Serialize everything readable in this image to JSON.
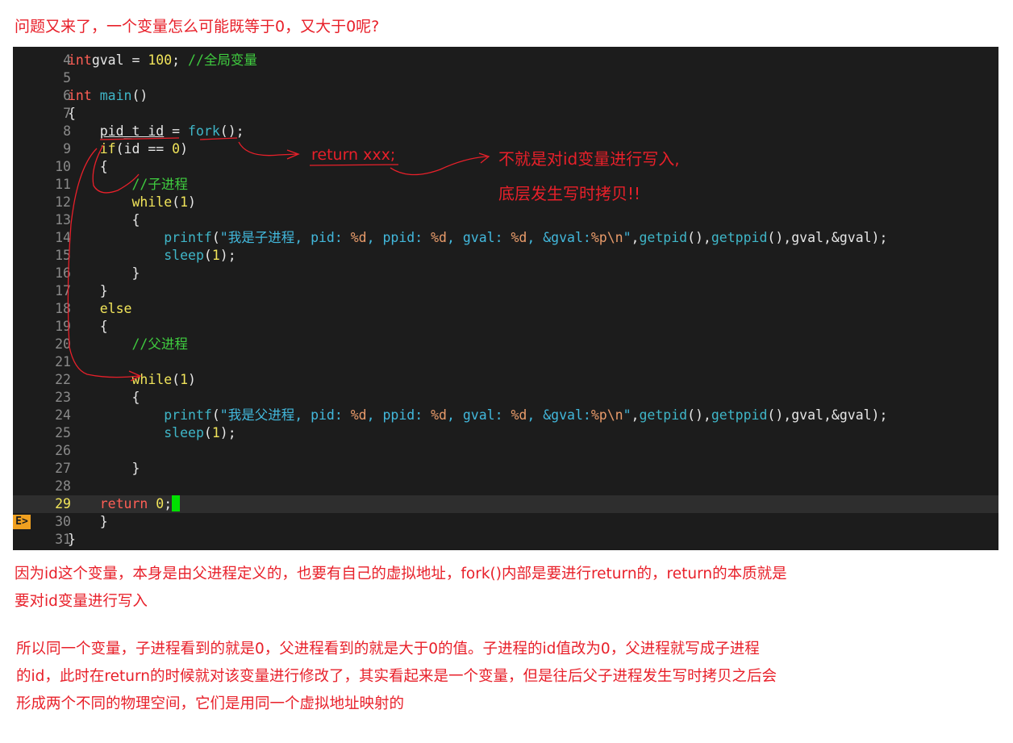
{
  "top_note": "问题又来了，一个变量怎么可能既等于0，又大于0呢?",
  "code": {
    "lines": [
      {
        "no": "4",
        "parts": [
          [
            "kw",
            "int"
          ],
          [
            "",
            "gval = "
          ],
          [
            "num",
            "100"
          ],
          [
            "",
            "; "
          ],
          [
            "cm",
            "//全局变量"
          ]
        ]
      },
      {
        "no": "5",
        "parts": []
      },
      {
        "no": "6",
        "parts": [
          [
            "kw",
            "int"
          ],
          [
            "",
            ""
          ],
          [
            "fn",
            " main"
          ],
          [
            "",
            "()"
          ]
        ]
      },
      {
        "no": "7",
        "parts": [
          [
            "",
            "{"
          ]
        ]
      },
      {
        "no": "8",
        "parts": [
          [
            "",
            "    "
          ],
          [
            "ul",
            "pid_t id"
          ],
          [
            "",
            " = "
          ],
          [
            "fn",
            "fork"
          ],
          [
            "",
            "();"
          ]
        ]
      },
      {
        "no": "9",
        "parts": [
          [
            "",
            "    "
          ],
          [
            "kw2",
            "if"
          ],
          [
            "",
            "(id == "
          ],
          [
            "num",
            "0"
          ],
          [
            "",
            ")"
          ]
        ]
      },
      {
        "no": "10",
        "parts": [
          [
            "",
            "    {"
          ]
        ]
      },
      {
        "no": "11",
        "parts": [
          [
            "",
            "        "
          ],
          [
            "cm",
            "//子进程"
          ]
        ]
      },
      {
        "no": "12",
        "parts": [
          [
            "",
            "        "
          ],
          [
            "kw2",
            "while"
          ],
          [
            "",
            "("
          ],
          [
            "num",
            "1"
          ],
          [
            "",
            ")"
          ]
        ]
      },
      {
        "no": "13",
        "parts": [
          [
            "",
            "        {"
          ]
        ]
      },
      {
        "no": "14",
        "parts": [
          [
            "",
            "            "
          ],
          [
            "fn",
            "printf"
          ],
          [
            "",
            "("
          ],
          [
            "str",
            "\"我是子进程, pid: "
          ],
          [
            "str2",
            "%d"
          ],
          [
            "str",
            ", ppid: "
          ],
          [
            "str2",
            "%d"
          ],
          [
            "str",
            ", gval: "
          ],
          [
            "str2",
            "%d"
          ],
          [
            "str",
            ", &gval:"
          ],
          [
            "str2",
            "%p\\n"
          ],
          [
            "str",
            "\""
          ],
          [
            "",
            ","
          ],
          [
            "fn",
            "getpid"
          ],
          [
            "",
            "(),"
          ],
          [
            "fn",
            "getppid"
          ],
          [
            "",
            "(),gval,&gval);"
          ]
        ]
      },
      {
        "no": "15",
        "parts": [
          [
            "",
            "            "
          ],
          [
            "fn",
            "sleep"
          ],
          [
            "",
            "("
          ],
          [
            "num",
            "1"
          ],
          [
            "",
            ");"
          ]
        ]
      },
      {
        "no": "16",
        "parts": [
          [
            "",
            "        }"
          ]
        ]
      },
      {
        "no": "17",
        "parts": [
          [
            "",
            "    }"
          ]
        ]
      },
      {
        "no": "18",
        "parts": [
          [
            "",
            "    "
          ],
          [
            "kw2",
            "else"
          ]
        ]
      },
      {
        "no": "19",
        "parts": [
          [
            "",
            "    {"
          ]
        ]
      },
      {
        "no": "20",
        "parts": [
          [
            "",
            "        "
          ],
          [
            "cm",
            "//父进程"
          ]
        ]
      },
      {
        "no": "21",
        "parts": []
      },
      {
        "no": "22",
        "parts": [
          [
            "",
            "        "
          ],
          [
            "kw2",
            "while"
          ],
          [
            "",
            "("
          ],
          [
            "num",
            "1"
          ],
          [
            "",
            ")"
          ]
        ]
      },
      {
        "no": "23",
        "parts": [
          [
            "",
            "        {"
          ]
        ]
      },
      {
        "no": "24",
        "parts": [
          [
            "",
            "            "
          ],
          [
            "fn",
            "printf"
          ],
          [
            "",
            "("
          ],
          [
            "str",
            "\"我是父进程, pid: "
          ],
          [
            "str2",
            "%d"
          ],
          [
            "str",
            ", ppid: "
          ],
          [
            "str2",
            "%d"
          ],
          [
            "str",
            ", gval: "
          ],
          [
            "str2",
            "%d"
          ],
          [
            "str",
            ", &gval:"
          ],
          [
            "str2",
            "%p\\n"
          ],
          [
            "str",
            "\""
          ],
          [
            "",
            ","
          ],
          [
            "fn",
            "getpid"
          ],
          [
            "",
            "(),"
          ],
          [
            "fn",
            "getppid"
          ],
          [
            "",
            "(),gval,&gval);"
          ]
        ]
      },
      {
        "no": "25",
        "parts": [
          [
            "",
            "            "
          ],
          [
            "fn",
            "sleep"
          ],
          [
            "",
            "("
          ],
          [
            "num",
            "1"
          ],
          [
            "",
            ");"
          ]
        ]
      },
      {
        "no": "26",
        "parts": []
      },
      {
        "no": "27",
        "parts": [
          [
            "",
            "        }"
          ]
        ]
      },
      {
        "no": "28",
        "parts": []
      },
      {
        "no": "29",
        "parts": [
          [
            "",
            "    "
          ],
          [
            "kw",
            "return"
          ],
          [
            "",
            " "
          ],
          [
            "num",
            "0"
          ],
          [
            "",
            ";"
          ]
        ],
        "current": true
      },
      {
        "no": "30",
        "parts": [
          [
            "",
            "    }"
          ]
        ],
        "sign": "E>"
      },
      {
        "no": "31",
        "parts": [
          [
            "",
            "}"
          ]
        ]
      }
    ]
  },
  "annotations": {
    "return_xxx": "return xxx;",
    "note_line1": "不就是对id变量进行写入,",
    "note_line2": "底层发生写时拷贝!!"
  },
  "bottom": {
    "para1_line1": "因为id这个变量，本身是由父进程定义的，也要有自己的虚拟地址，fork()内部是要进行return的，return的本质就是",
    "para1_line2": "要对id变量进行写入",
    "para2_line1": "所以同一个变量，子进程看到的就是0，父进程看到的就是大于0的值。子进程的id值改为0，父进程就写成子进程",
    "para2_line2": "的id，此时在return的时候就对该变量进行修改了，其实看起来是一个变量，但是往后父子进程发生写时拷贝之后会",
    "para2_line3": "形成两个不同的物理空间，它们是用同一个虚拟地址映射的"
  },
  "colors": {
    "annotation": "#e8202a",
    "editor_bg": "#1c1c1c",
    "keyword": "#ff5f56",
    "control": "#f1e45a",
    "function": "#3fb6c8",
    "comment": "#3fcb3f",
    "cursor": "#00e000"
  }
}
